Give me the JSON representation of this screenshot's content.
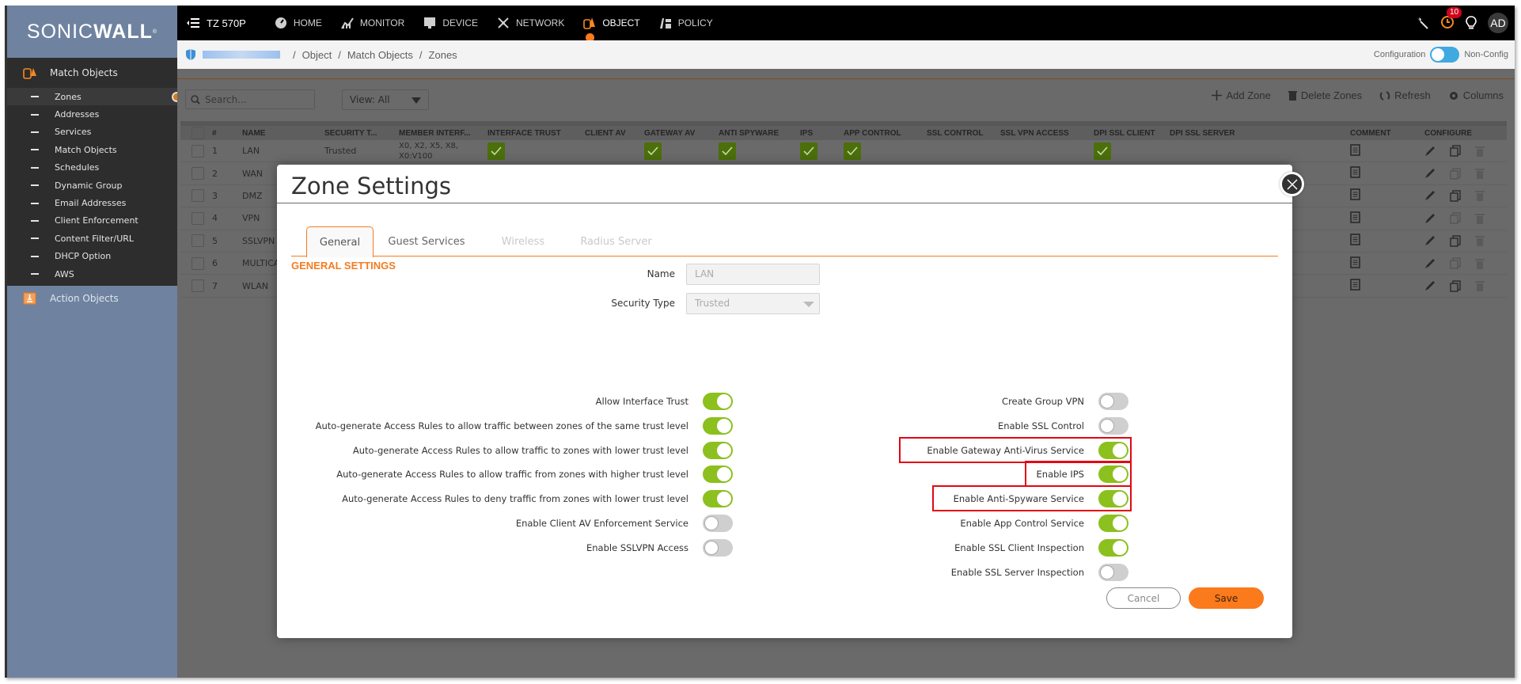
{
  "brand": {
    "logo_light": "SONIC",
    "logo_bold": "WALL"
  },
  "topnav": {
    "device": "TZ 570P",
    "items": [
      {
        "label": "HOME",
        "icon": "dashboard-icon"
      },
      {
        "label": "MONITOR",
        "icon": "chart-icon"
      },
      {
        "label": "DEVICE",
        "icon": "monitor-icon"
      },
      {
        "label": "NETWORK",
        "icon": "network-icon"
      },
      {
        "label": "OBJECT",
        "icon": "object-icon",
        "active": true
      },
      {
        "label": "POLICY",
        "icon": "policy-icon"
      }
    ],
    "notification_count": "10",
    "avatar": "AD"
  },
  "breadcrumb": {
    "items": [
      "Object",
      "Match Objects",
      "Zones"
    ],
    "mode_left": "Configuration",
    "mode_right": "Non-Config"
  },
  "sidebar": {
    "group": "Match Objects",
    "items": [
      "Zones",
      "Addresses",
      "Services",
      "Match Objects",
      "Schedules",
      "Dynamic Group",
      "Email Addresses",
      "Client Enforcement",
      "Content Filter/URL",
      "DHCP Option",
      "AWS"
    ],
    "active_item": "Zones",
    "group2": "Action Objects"
  },
  "toolbar": {
    "search_placeholder": "Search...",
    "view": "View: All",
    "add": "Add Zone",
    "delete": "Delete Zones",
    "refresh": "Refresh",
    "columns": "Columns"
  },
  "table": {
    "headers": [
      "#",
      "NAME",
      "SECURITY T...",
      "MEMBER INTERF...",
      "INTERFACE TRUST",
      "CLIENT AV",
      "GATEWAY AV",
      "ANTI SPYWARE",
      "IPS",
      "APP CONTROL",
      "SSL CONTROL",
      "SSL VPN ACCESS",
      "DPI SSL CLIENT",
      "DPI SSL SERVER",
      "COMMENT",
      "CONFIGURE"
    ],
    "rows": [
      {
        "num": "1",
        "name": "LAN",
        "security": "Trusted",
        "members": "X0, X2, X5, X8, X0:V100",
        "interface_trust": true,
        "client_av": false,
        "gateway_av": true,
        "anti_spyware": true,
        "ips": true,
        "app_control": true,
        "ssl_control": false,
        "sslvpn": false,
        "dpi_client": true,
        "dpi_server": false
      },
      {
        "num": "2",
        "name": "WAN"
      },
      {
        "num": "3",
        "name": "DMZ"
      },
      {
        "num": "4",
        "name": "VPN"
      },
      {
        "num": "5",
        "name": "SSLVPN"
      },
      {
        "num": "6",
        "name": "MULTICAST"
      },
      {
        "num": "7",
        "name": "WLAN"
      }
    ]
  },
  "modal": {
    "title": "Zone Settings",
    "tabs": [
      {
        "label": "General",
        "state": "active"
      },
      {
        "label": "Guest Services",
        "state": "normal"
      },
      {
        "label": "Wireless",
        "state": "disabled"
      },
      {
        "label": "Radius Server",
        "state": "disabled"
      }
    ],
    "section": "GENERAL SETTINGS",
    "name_label": "Name",
    "name_value": "LAN",
    "security_label": "Security Type",
    "security_value": "Trusted",
    "left_options": [
      {
        "label": "Allow Interface Trust",
        "on": true
      },
      {
        "label": "Auto-generate Access Rules to allow traffic between zones of the same trust level",
        "on": true
      },
      {
        "label": "Auto-generate Access Rules to allow traffic to zones with lower trust level",
        "on": true
      },
      {
        "label": "Auto-generate Access Rules to allow traffic from zones with higher trust level",
        "on": true
      },
      {
        "label": "Auto-generate Access Rules to deny traffic from zones with lower trust level",
        "on": true
      },
      {
        "label": "Enable Client AV Enforcement Service",
        "on": false
      },
      {
        "label": "Enable SSLVPN Access",
        "on": false
      }
    ],
    "right_options": [
      {
        "label": "Create Group VPN",
        "on": false
      },
      {
        "label": "Enable SSL Control",
        "on": false
      },
      {
        "label": "Enable Gateway Anti-Virus Service",
        "on": true,
        "highlighted": true
      },
      {
        "label": "Enable IPS",
        "on": true,
        "highlighted": true
      },
      {
        "label": "Enable Anti-Spyware Service",
        "on": true,
        "highlighted": true
      },
      {
        "label": "Enable App Control Service",
        "on": true
      },
      {
        "label": "Enable SSL Client Inspection",
        "on": true
      },
      {
        "label": "Enable SSL Server Inspection",
        "on": false
      }
    ],
    "cancel": "Cancel",
    "save": "Save"
  },
  "colors": {
    "accent": "#f47c20",
    "toggle_on": "#8cc01f",
    "highlight": "#e30613"
  }
}
